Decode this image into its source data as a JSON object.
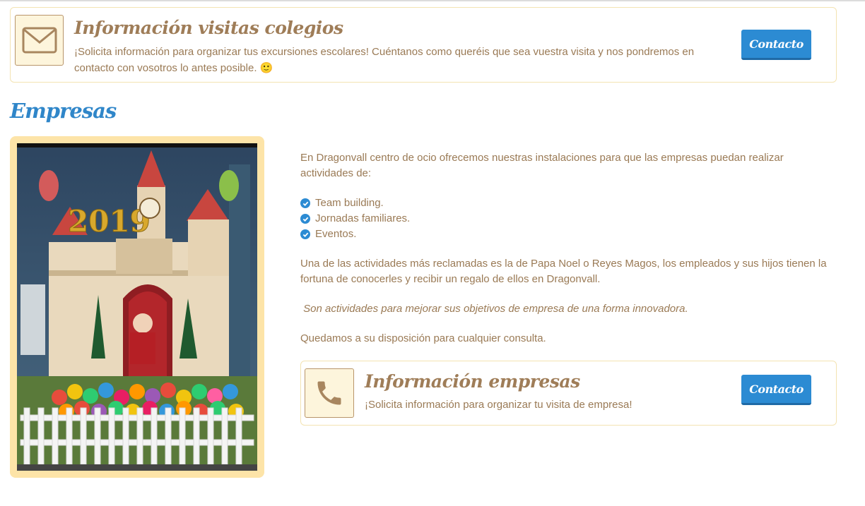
{
  "colegios": {
    "title": "Información visitas colegios",
    "text": "¡Solicita información para organizar tus excursiones escolares! Cuéntanos como queréis que sea vuestra visita y nos pondremos en contacto con vosotros lo antes posible.",
    "emoji": "🙂",
    "button": "Contacto",
    "icon": "envelope-icon"
  },
  "empresas": {
    "section_title": "Empresas",
    "photo_year": "2019",
    "intro": "En Dragonvall centro de ocio ofrecemos nuestras instalaciones para que las empresas puedan realizar actividades de:",
    "activities": [
      "Team building.",
      "Jornadas familiares.",
      "Eventos."
    ],
    "paragraph": "Una de las actividades más reclamadas es la de Papa Noel o Reyes Magos, los empleados y sus hijos tienen la fortuna de conocerles y recibir un regalo de ellos en Dragonvall.",
    "italic_note": " Son actividades para mejorar sus objetivos de empresa de una forma innovadora.",
    "closing": "Quedamos a su disposición para cualquier consulta.",
    "info_box": {
      "title": "Información empresas",
      "text": "¡Solicita información para organizar tu visita de empresa!",
      "button": "Contacto",
      "icon": "phone-icon"
    }
  },
  "colors": {
    "accent_blue": "#2c8bd3",
    "brown_text": "#9a7a55",
    "frame_yellow": "#fde4a8"
  }
}
